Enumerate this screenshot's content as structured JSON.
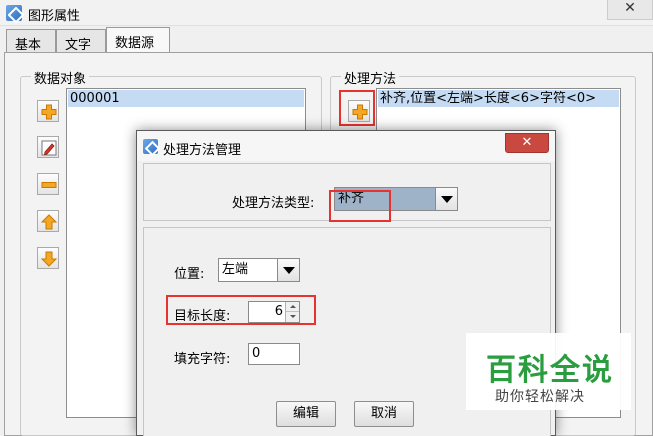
{
  "window": {
    "title": "图形属性",
    "close_glyph": "✕"
  },
  "tabs": [
    {
      "label": "基本"
    },
    {
      "label": "文字"
    },
    {
      "label": "数据源",
      "active": true
    }
  ],
  "data_objects": {
    "title": "数据对象",
    "items": [
      "000001"
    ],
    "toolbar_icons": [
      "add-icon",
      "edit-icon",
      "remove-icon",
      "move-up-icon",
      "move-down-icon"
    ]
  },
  "processing": {
    "title": "处理方法",
    "items": [
      "补齐,位置<左端>长度<6>字符<0>"
    ],
    "toolbar_icons": [
      "add-icon"
    ]
  },
  "dialog": {
    "title": "处理方法管理",
    "close_glyph": "✕",
    "method_type": {
      "label": "处理方法类型:",
      "value": "补齐"
    },
    "position": {
      "label": "位置:",
      "value": "左端"
    },
    "target_length": {
      "label": "目标长度:",
      "value": "6"
    },
    "fill_char": {
      "label": "填充字符:",
      "value": "0"
    },
    "edit_button": "编辑",
    "cancel_button": "取消"
  },
  "watermark": {
    "title": "百科全说",
    "subtitle": "助你轻松解决"
  },
  "colors": {
    "highlight_red": "#e8322e",
    "selection_blue": "#c5dbf3",
    "icon_orange": "#f5a623",
    "watermark_green": "#2a9d3f"
  }
}
